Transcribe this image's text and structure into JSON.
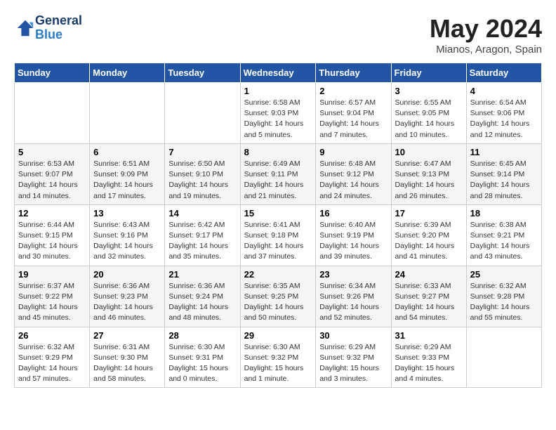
{
  "header": {
    "logo_line1": "General",
    "logo_line2": "Blue",
    "month_title": "May 2024",
    "location": "Mianos, Aragon, Spain"
  },
  "weekdays": [
    "Sunday",
    "Monday",
    "Tuesday",
    "Wednesday",
    "Thursday",
    "Friday",
    "Saturday"
  ],
  "weeks": [
    [
      {
        "day": "",
        "info": ""
      },
      {
        "day": "",
        "info": ""
      },
      {
        "day": "",
        "info": ""
      },
      {
        "day": "1",
        "info": "Sunrise: 6:58 AM\nSunset: 9:03 PM\nDaylight: 14 hours\nand 5 minutes."
      },
      {
        "day": "2",
        "info": "Sunrise: 6:57 AM\nSunset: 9:04 PM\nDaylight: 14 hours\nand 7 minutes."
      },
      {
        "day": "3",
        "info": "Sunrise: 6:55 AM\nSunset: 9:05 PM\nDaylight: 14 hours\nand 10 minutes."
      },
      {
        "day": "4",
        "info": "Sunrise: 6:54 AM\nSunset: 9:06 PM\nDaylight: 14 hours\nand 12 minutes."
      }
    ],
    [
      {
        "day": "5",
        "info": "Sunrise: 6:53 AM\nSunset: 9:07 PM\nDaylight: 14 hours\nand 14 minutes."
      },
      {
        "day": "6",
        "info": "Sunrise: 6:51 AM\nSunset: 9:09 PM\nDaylight: 14 hours\nand 17 minutes."
      },
      {
        "day": "7",
        "info": "Sunrise: 6:50 AM\nSunset: 9:10 PM\nDaylight: 14 hours\nand 19 minutes."
      },
      {
        "day": "8",
        "info": "Sunrise: 6:49 AM\nSunset: 9:11 PM\nDaylight: 14 hours\nand 21 minutes."
      },
      {
        "day": "9",
        "info": "Sunrise: 6:48 AM\nSunset: 9:12 PM\nDaylight: 14 hours\nand 24 minutes."
      },
      {
        "day": "10",
        "info": "Sunrise: 6:47 AM\nSunset: 9:13 PM\nDaylight: 14 hours\nand 26 minutes."
      },
      {
        "day": "11",
        "info": "Sunrise: 6:45 AM\nSunset: 9:14 PM\nDaylight: 14 hours\nand 28 minutes."
      }
    ],
    [
      {
        "day": "12",
        "info": "Sunrise: 6:44 AM\nSunset: 9:15 PM\nDaylight: 14 hours\nand 30 minutes."
      },
      {
        "day": "13",
        "info": "Sunrise: 6:43 AM\nSunset: 9:16 PM\nDaylight: 14 hours\nand 32 minutes."
      },
      {
        "day": "14",
        "info": "Sunrise: 6:42 AM\nSunset: 9:17 PM\nDaylight: 14 hours\nand 35 minutes."
      },
      {
        "day": "15",
        "info": "Sunrise: 6:41 AM\nSunset: 9:18 PM\nDaylight: 14 hours\nand 37 minutes."
      },
      {
        "day": "16",
        "info": "Sunrise: 6:40 AM\nSunset: 9:19 PM\nDaylight: 14 hours\nand 39 minutes."
      },
      {
        "day": "17",
        "info": "Sunrise: 6:39 AM\nSunset: 9:20 PM\nDaylight: 14 hours\nand 41 minutes."
      },
      {
        "day": "18",
        "info": "Sunrise: 6:38 AM\nSunset: 9:21 PM\nDaylight: 14 hours\nand 43 minutes."
      }
    ],
    [
      {
        "day": "19",
        "info": "Sunrise: 6:37 AM\nSunset: 9:22 PM\nDaylight: 14 hours\nand 45 minutes."
      },
      {
        "day": "20",
        "info": "Sunrise: 6:36 AM\nSunset: 9:23 PM\nDaylight: 14 hours\nand 46 minutes."
      },
      {
        "day": "21",
        "info": "Sunrise: 6:36 AM\nSunset: 9:24 PM\nDaylight: 14 hours\nand 48 minutes."
      },
      {
        "day": "22",
        "info": "Sunrise: 6:35 AM\nSunset: 9:25 PM\nDaylight: 14 hours\nand 50 minutes."
      },
      {
        "day": "23",
        "info": "Sunrise: 6:34 AM\nSunset: 9:26 PM\nDaylight: 14 hours\nand 52 minutes."
      },
      {
        "day": "24",
        "info": "Sunrise: 6:33 AM\nSunset: 9:27 PM\nDaylight: 14 hours\nand 54 minutes."
      },
      {
        "day": "25",
        "info": "Sunrise: 6:32 AM\nSunset: 9:28 PM\nDaylight: 14 hours\nand 55 minutes."
      }
    ],
    [
      {
        "day": "26",
        "info": "Sunrise: 6:32 AM\nSunset: 9:29 PM\nDaylight: 14 hours\nand 57 minutes."
      },
      {
        "day": "27",
        "info": "Sunrise: 6:31 AM\nSunset: 9:30 PM\nDaylight: 14 hours\nand 58 minutes."
      },
      {
        "day": "28",
        "info": "Sunrise: 6:30 AM\nSunset: 9:31 PM\nDaylight: 15 hours\nand 0 minutes."
      },
      {
        "day": "29",
        "info": "Sunrise: 6:30 AM\nSunset: 9:32 PM\nDaylight: 15 hours\nand 1 minute."
      },
      {
        "day": "30",
        "info": "Sunrise: 6:29 AM\nSunset: 9:32 PM\nDaylight: 15 hours\nand 3 minutes."
      },
      {
        "day": "31",
        "info": "Sunrise: 6:29 AM\nSunset: 9:33 PM\nDaylight: 15 hours\nand 4 minutes."
      },
      {
        "day": "",
        "info": ""
      }
    ]
  ]
}
